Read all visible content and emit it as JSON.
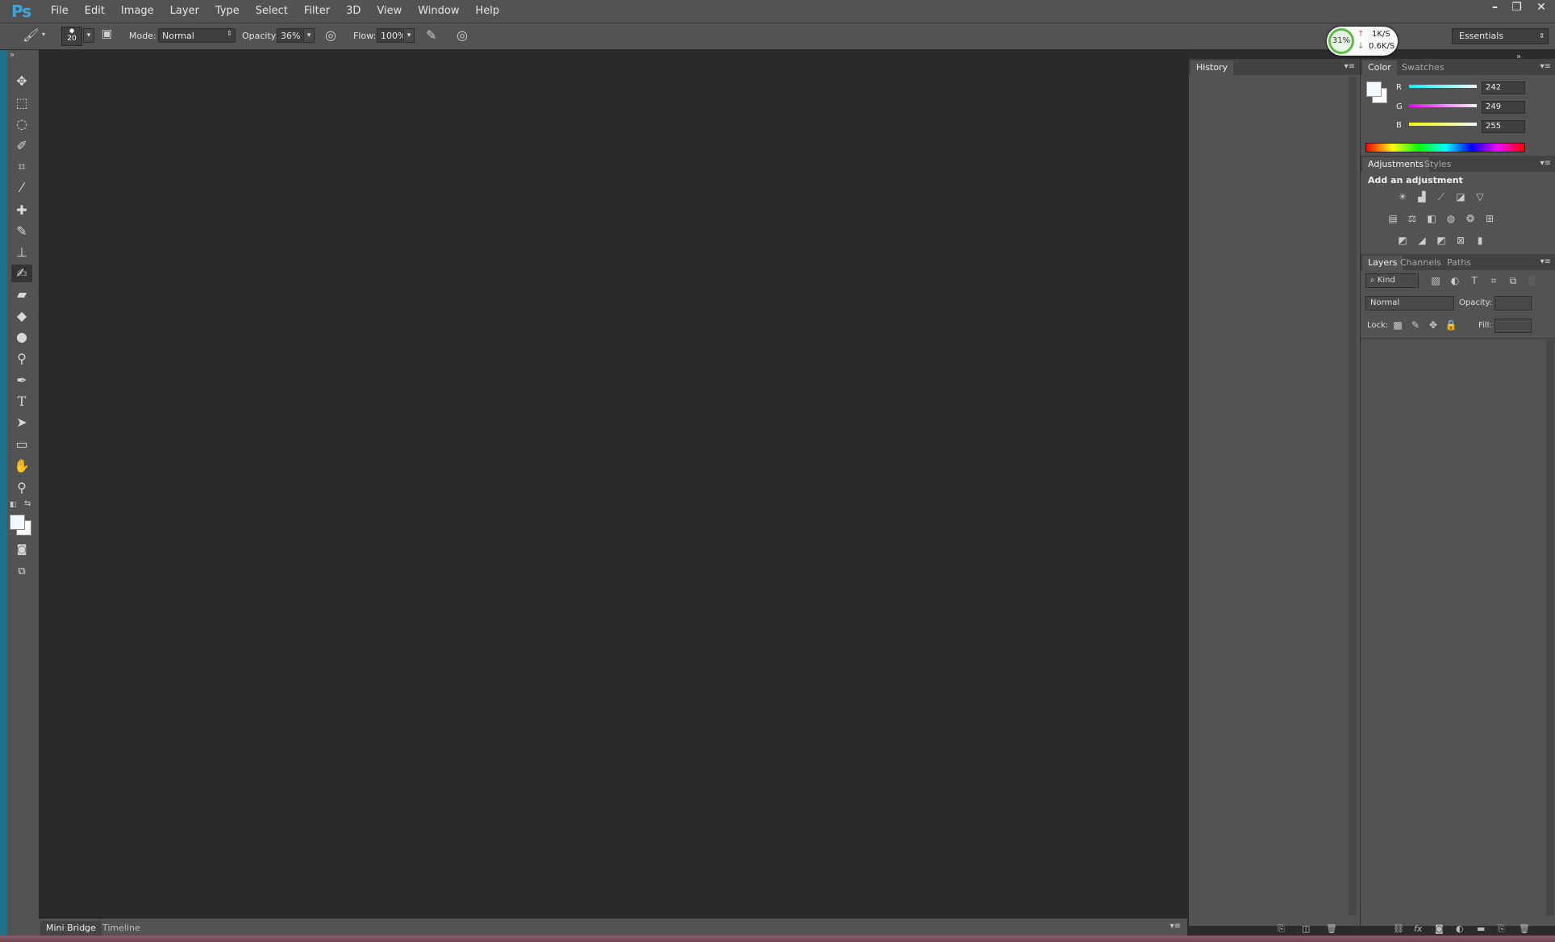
{
  "app": {
    "logo": "Ps"
  },
  "menu": [
    "File",
    "Edit",
    "Image",
    "Layer",
    "Type",
    "Select",
    "Filter",
    "3D",
    "View",
    "Window",
    "Help"
  ],
  "window_controls": {
    "minimize": "–",
    "restore": "❐",
    "close": "✕"
  },
  "options_bar": {
    "brush_size": "20",
    "mode_label": "Mode:",
    "mode_value": "Normal",
    "opacity_label": "Opacity:",
    "opacity_value": "36%",
    "flow_label": "Flow:",
    "flow_value": "100%"
  },
  "network_monitor": {
    "percent": "31%",
    "upload": "1K/S",
    "download": "0.6K/S"
  },
  "workspace": "Essentials",
  "bottom_tabs": [
    "Mini Bridge",
    "Timeline"
  ],
  "history_panel": {
    "tab": "History"
  },
  "color_panel": {
    "tabs": [
      "Color",
      "Swatches"
    ],
    "r_label": "R",
    "r_value": "242",
    "g_label": "G",
    "g_value": "249",
    "b_label": "B",
    "b_value": "255",
    "foreground_color": "#f2f9ff",
    "background_color": "#ffffff"
  },
  "adjustments_panel": {
    "tabs": [
      "Adjustments",
      "Styles"
    ],
    "title": "Add an adjustment"
  },
  "layers_panel": {
    "tabs": [
      "Layers",
      "Channels",
      "Paths"
    ],
    "filter_kind": "Kind",
    "blend_mode": "Normal",
    "opacity_label": "Opacity:",
    "lock_label": "Lock:",
    "fill_label": "Fill:"
  },
  "colors": {
    "accent": "#39a6e0",
    "panel": "#535353",
    "canvas": "#282828"
  }
}
